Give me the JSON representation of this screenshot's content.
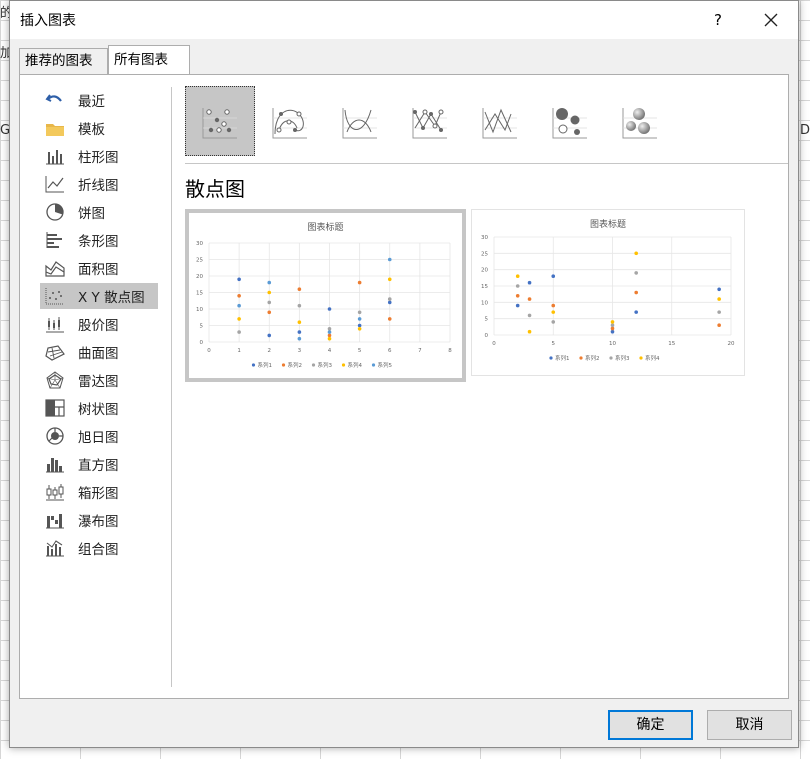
{
  "dialog": {
    "title": "插入图表",
    "help": "?",
    "tabs": [
      "推荐的图表",
      "所有图表"
    ],
    "ok_label": "确定",
    "cancel_label": "取消"
  },
  "background": {
    "frag1": "的",
    "frag2": "G",
    "frag3": "加",
    "frag4": "D"
  },
  "sidebar": {
    "items": [
      {
        "label": "最近",
        "icon": "undo-arrow-icon"
      },
      {
        "label": "模板",
        "icon": "folder-icon"
      },
      {
        "label": "柱形图",
        "icon": "column-chart-icon"
      },
      {
        "label": "折线图",
        "icon": "line-chart-icon"
      },
      {
        "label": "饼图",
        "icon": "pie-chart-icon"
      },
      {
        "label": "条形图",
        "icon": "bar-chart-icon"
      },
      {
        "label": "面积图",
        "icon": "area-chart-icon"
      },
      {
        "label": "X Y 散点图",
        "icon": "scatter-chart-icon"
      },
      {
        "label": "股价图",
        "icon": "stock-chart-icon"
      },
      {
        "label": "曲面图",
        "icon": "surface-chart-icon"
      },
      {
        "label": "雷达图",
        "icon": "radar-chart-icon"
      },
      {
        "label": "树状图",
        "icon": "treemap-chart-icon"
      },
      {
        "label": "旭日图",
        "icon": "sunburst-chart-icon"
      },
      {
        "label": "直方图",
        "icon": "histogram-chart-icon"
      },
      {
        "label": "箱形图",
        "icon": "box-whisker-chart-icon"
      },
      {
        "label": "瀑布图",
        "icon": "waterfall-chart-icon"
      },
      {
        "label": "组合图",
        "icon": "combo-chart-icon"
      }
    ],
    "selected_index": 7
  },
  "subtypes": {
    "icons": [
      "scatter-icon",
      "scatter-smooth-lines-markers-icon",
      "scatter-smooth-lines-icon",
      "scatter-straight-lines-markers-icon",
      "scatter-straight-lines-icon",
      "bubble-icon",
      "3d-bubble-icon"
    ],
    "selected_index": 0
  },
  "main": {
    "heading": "散点图"
  },
  "colors": {
    "s1": "#4472c4",
    "s2": "#ed7d31",
    "s3": "#a5a5a5",
    "s4": "#ffc000",
    "s5": "#5b9bd5",
    "accent": "#0078d7"
  },
  "chart_data": [
    {
      "type": "scatter",
      "title": "图表标题",
      "xlim": [
        0,
        8
      ],
      "ylim": [
        0,
        30
      ],
      "xticks": [
        "0",
        "1",
        "2",
        "3",
        "4",
        "5",
        "6",
        "7",
        "8"
      ],
      "yticks": [
        "0",
        "5",
        "10",
        "15",
        "20",
        "25",
        "30"
      ],
      "legend_position": "bottom",
      "series": [
        {
          "name": "系列1",
          "points": [
            [
              1,
              19
            ],
            [
              2,
              2
            ],
            [
              3,
              3
            ],
            [
              4,
              10
            ],
            [
              5,
              5
            ],
            [
              6,
              12
            ]
          ]
        },
        {
          "name": "系列2",
          "points": [
            [
              1,
              14
            ],
            [
              2,
              9
            ],
            [
              3,
              16
            ],
            [
              4,
              2
            ],
            [
              5,
              18
            ],
            [
              6,
              7
            ]
          ]
        },
        {
          "name": "系列3",
          "points": [
            [
              1,
              3
            ],
            [
              2,
              12
            ],
            [
              3,
              11
            ],
            [
              4,
              4
            ],
            [
              5,
              9
            ],
            [
              6,
              13
            ]
          ]
        },
        {
          "name": "系列4",
          "points": [
            [
              1,
              7
            ],
            [
              2,
              15
            ],
            [
              3,
              6
            ],
            [
              4,
              1
            ],
            [
              5,
              4
            ],
            [
              6,
              19
            ]
          ]
        },
        {
          "name": "系列5",
          "points": [
            [
              1,
              11
            ],
            [
              2,
              18
            ],
            [
              3,
              1
            ],
            [
              4,
              3
            ],
            [
              5,
              7
            ],
            [
              6,
              25
            ]
          ]
        }
      ]
    },
    {
      "type": "scatter",
      "title": "图表标题",
      "xlim": [
        0,
        20
      ],
      "ylim": [
        0,
        30
      ],
      "xticks": [
        "0",
        "5",
        "10",
        "15",
        "20"
      ],
      "yticks": [
        "0",
        "5",
        "10",
        "15",
        "20",
        "25",
        "30"
      ],
      "legend_position": "bottom",
      "series": [
        {
          "name": "系列1",
          "points": [
            [
              2,
              9
            ],
            [
              3,
              16
            ],
            [
              5,
              18
            ],
            [
              10,
              1
            ],
            [
              12,
              7
            ],
            [
              19,
              14
            ]
          ]
        },
        {
          "name": "系列2",
          "points": [
            [
              2,
              12
            ],
            [
              3,
              11
            ],
            [
              5,
              9
            ],
            [
              10,
              2
            ],
            [
              12,
              13
            ],
            [
              19,
              3
            ]
          ]
        },
        {
          "name": "系列3",
          "points": [
            [
              2,
              15
            ],
            [
              3,
              6
            ],
            [
              5,
              4
            ],
            [
              10,
              3
            ],
            [
              12,
              19
            ],
            [
              19,
              7
            ]
          ]
        },
        {
          "name": "系列4",
          "points": [
            [
              2,
              18
            ],
            [
              3,
              1
            ],
            [
              5,
              7
            ],
            [
              10,
              4
            ],
            [
              12,
              25
            ],
            [
              19,
              11
            ]
          ]
        }
      ]
    }
  ]
}
